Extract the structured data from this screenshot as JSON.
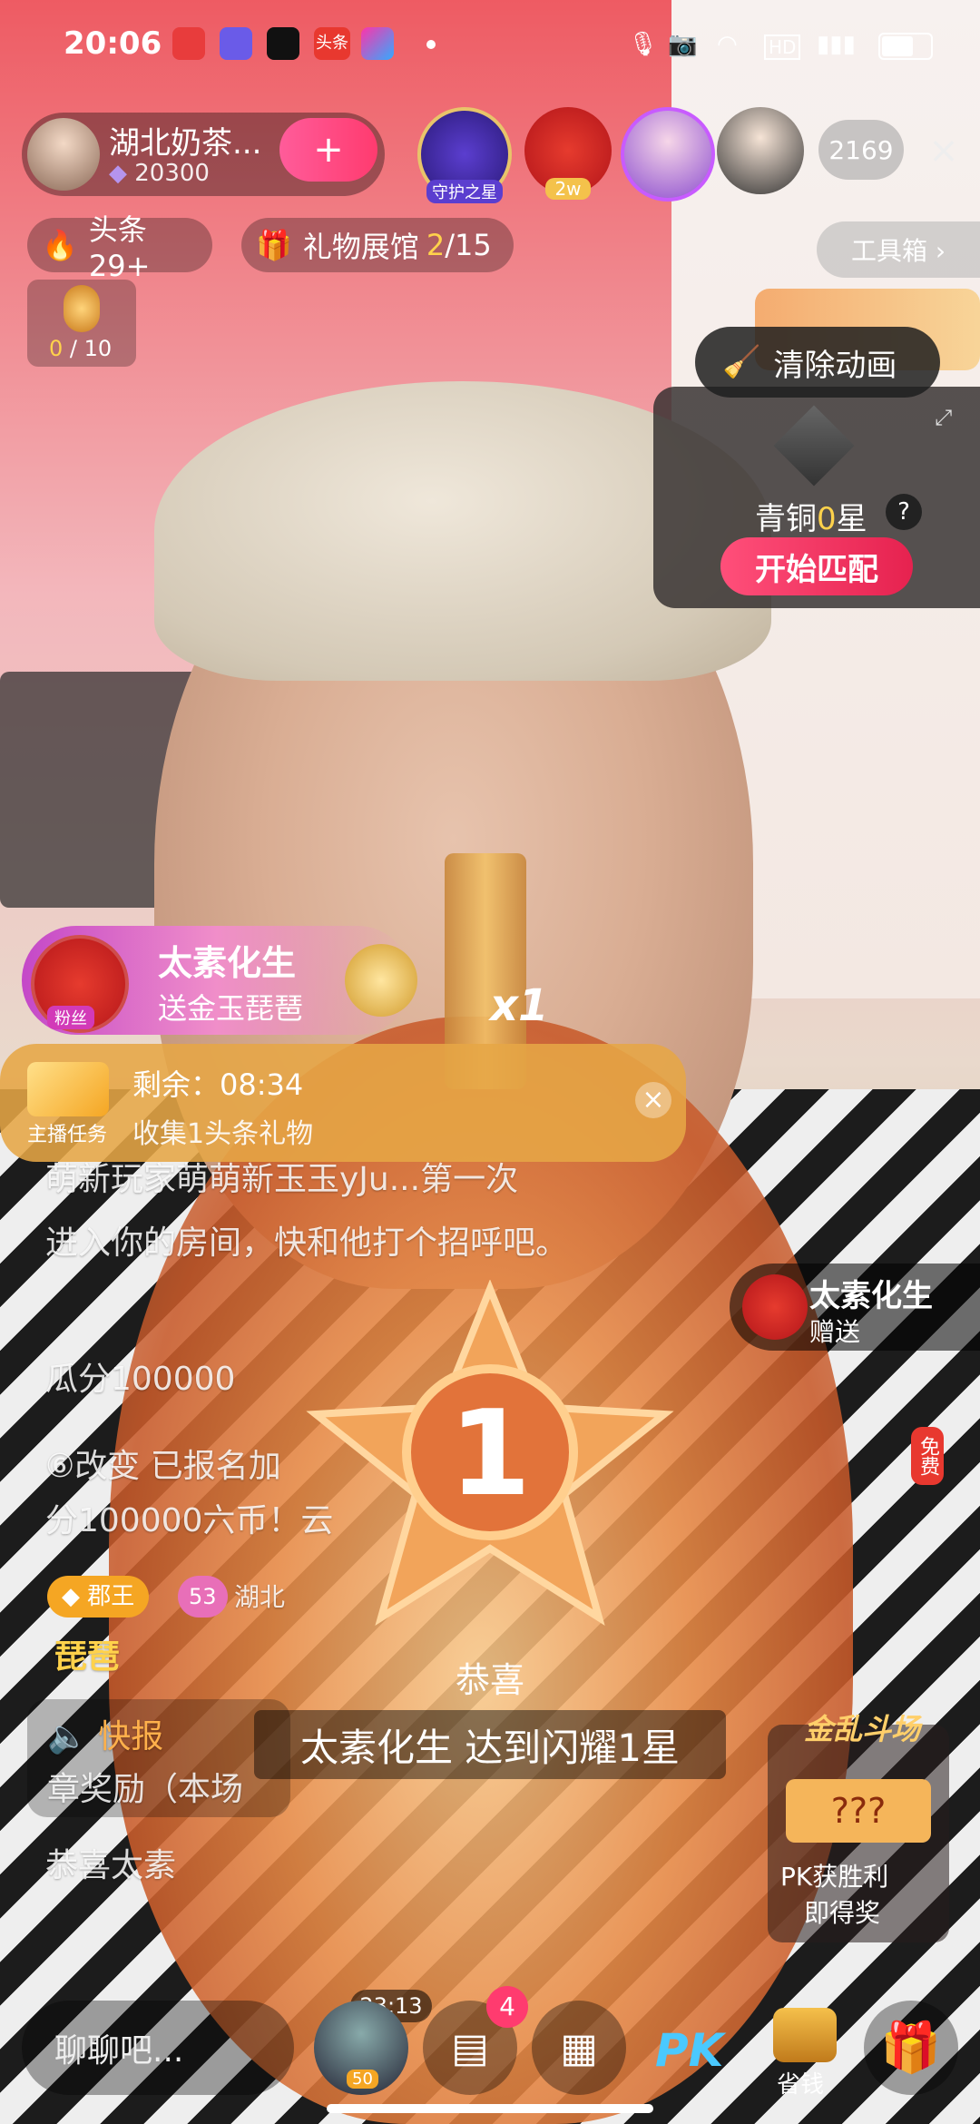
{
  "status_bar": {
    "time": "20:06",
    "app_icons": [
      "app-red-icon",
      "app-purple-icon",
      "tiktok-icon",
      "toutiao-icon",
      "app-colorful-icon"
    ],
    "toutiao_label": "头条",
    "right_icons": [
      "mic-icon",
      "camera-icon",
      "wifi-icon",
      "hd-icon",
      "signal-icon",
      "battery-icon"
    ],
    "hd_label": "HD"
  },
  "host": {
    "name": "湖北奶茶...",
    "score": "20300",
    "follow_symbol": "+"
  },
  "top_badges": [
    {
      "label": "守护之星"
    },
    {
      "label": "2w"
    }
  ],
  "viewer_count": "2169",
  "close_symbol": "×",
  "headline": {
    "label": "头条29+"
  },
  "gift_hall": {
    "label": "礼物展馆",
    "current": "2",
    "total": "/15"
  },
  "toolbox": {
    "label": "工具箱 ›"
  },
  "gift_progress": {
    "current": "0",
    "total": " / 10"
  },
  "clear_animation": {
    "label": "清除动画"
  },
  "pk_card": {
    "rank_label": "青铜",
    "rank_value": "0",
    "rank_unit": "星",
    "help": "?",
    "start_button": "开始匹配"
  },
  "gift_notice": {
    "badge_label": "粉丝",
    "sender": "太素化生",
    "action": "送金玉琵琶",
    "multiplier": "x1"
  },
  "task": {
    "badge": "主播任务",
    "remaining_label": "剩余：08:34",
    "desc": "收集1头条礼物",
    "close_symbol": "×"
  },
  "chat_lines": [
    "萌新玩家萌萌新玉玉yJu...第一次",
    "进入你的房间，快和他打个招呼吧。",
    "瓜分100000",
    "⑥改变 已报名加",
    "分100000六币！云",
    "琵琶",
    "快报",
    "章奖励（本场",
    "恭喜太素"
  ],
  "chat_badges": {
    "title": "郡王",
    "level": "53",
    "city": "湖北"
  },
  "side_gift": {
    "sender": "太素化生",
    "action": "赠送"
  },
  "free_badge": "免费",
  "star_number": "1",
  "congrats": "恭喜",
  "achievement": "太素化生 达到闪耀1星",
  "mixed_battle": {
    "title": "金乱斗场",
    "line1": "PK获胜利",
    "line2": "即得奖"
  },
  "bottom_bar": {
    "chat_placeholder": "聊聊吧...",
    "timer": "23:13",
    "avatar_level": "50",
    "message_badge": "4",
    "pk_label": "PK",
    "save_label": "省钱"
  }
}
